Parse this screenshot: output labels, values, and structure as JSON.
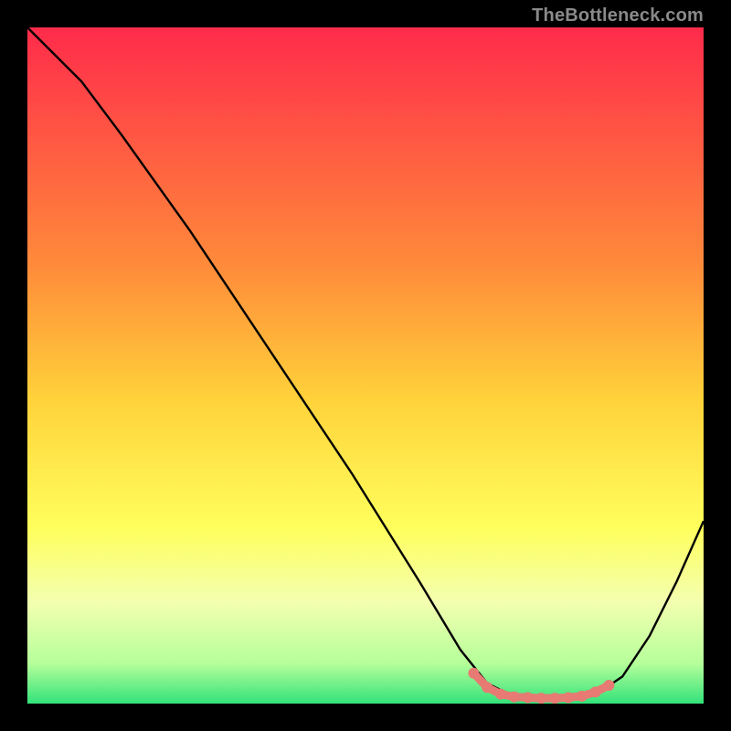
{
  "watermark": "TheBottleneck.com",
  "chart_data": {
    "type": "line",
    "title": "",
    "xlabel": "",
    "ylabel": "",
    "xlim": [
      0,
      100
    ],
    "ylim": [
      0,
      100
    ],
    "grid": false,
    "legend": false,
    "gradient_stops": [
      {
        "offset": 0,
        "color": "#ff2b4b"
      },
      {
        "offset": 35,
        "color": "#ff8a3a"
      },
      {
        "offset": 55,
        "color": "#ffd23a"
      },
      {
        "offset": 74,
        "color": "#ffff5c"
      },
      {
        "offset": 85,
        "color": "#f3ffb0"
      },
      {
        "offset": 94,
        "color": "#b6ff9a"
      },
      {
        "offset": 100,
        "color": "#33e27a"
      }
    ],
    "series": [
      {
        "name": "bottleneck-curve",
        "color": "#000000",
        "points": [
          {
            "x": 0,
            "y": 100
          },
          {
            "x": 8,
            "y": 92
          },
          {
            "x": 14,
            "y": 84
          },
          {
            "x": 24,
            "y": 70
          },
          {
            "x": 36,
            "y": 52
          },
          {
            "x": 48,
            "y": 34
          },
          {
            "x": 58,
            "y": 18
          },
          {
            "x": 64,
            "y": 8
          },
          {
            "x": 68,
            "y": 3
          },
          {
            "x": 72,
            "y": 1
          },
          {
            "x": 78,
            "y": 0.8
          },
          {
            "x": 84,
            "y": 1.3
          },
          {
            "x": 88,
            "y": 4
          },
          {
            "x": 92,
            "y": 10
          },
          {
            "x": 96,
            "y": 18
          },
          {
            "x": 100,
            "y": 27
          }
        ]
      },
      {
        "name": "optimal-range-markers",
        "color": "#e77a73",
        "points": [
          {
            "x": 66,
            "y": 4.5
          },
          {
            "x": 68,
            "y": 2.4
          },
          {
            "x": 70,
            "y": 1.4
          },
          {
            "x": 72,
            "y": 1.0
          },
          {
            "x": 74,
            "y": 0.9
          },
          {
            "x": 76,
            "y": 0.8
          },
          {
            "x": 78,
            "y": 0.8
          },
          {
            "x": 80,
            "y": 0.9
          },
          {
            "x": 82,
            "y": 1.1
          },
          {
            "x": 84,
            "y": 1.7
          },
          {
            "x": 86,
            "y": 2.7
          }
        ]
      }
    ]
  }
}
